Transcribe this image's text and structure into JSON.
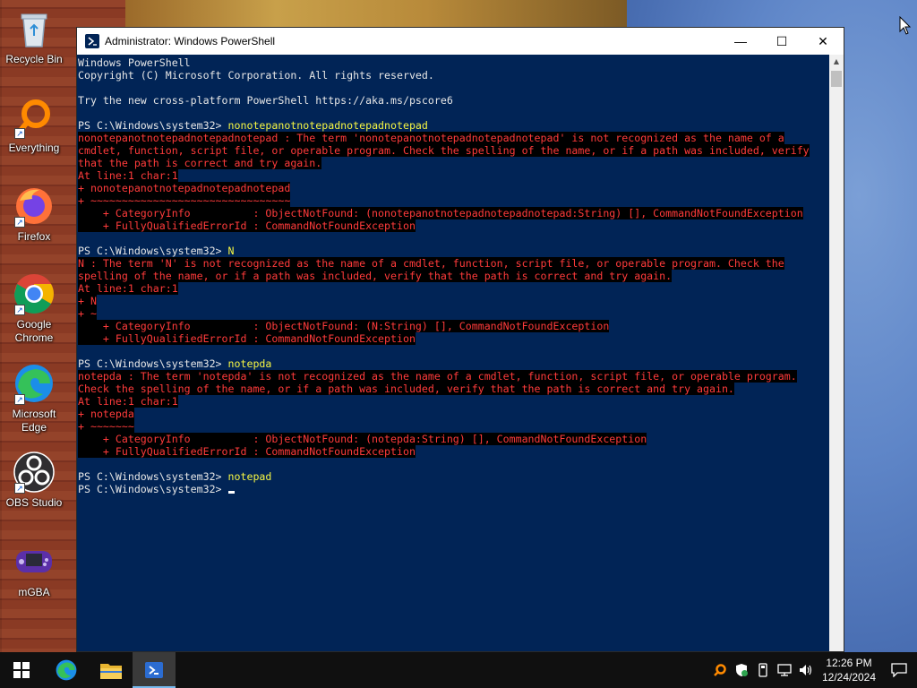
{
  "desktop": {
    "icons": [
      {
        "label": "Recycle Bin"
      },
      {
        "label": "Everything"
      },
      {
        "label": "Firefox"
      },
      {
        "label": "Google Chrome"
      },
      {
        "label": "Microsoft Edge"
      },
      {
        "label": "OBS Studio"
      },
      {
        "label": "mGBA"
      }
    ]
  },
  "window": {
    "title": "Administrator: Windows PowerShell",
    "controls": {
      "minimize": "—",
      "maximize": "☐",
      "close": "✕"
    }
  },
  "console": {
    "lines": [
      {
        "type": "out",
        "text": "Windows PowerShell"
      },
      {
        "type": "out",
        "text": "Copyright (C) Microsoft Corporation. All rights reserved."
      },
      {
        "type": "out",
        "text": ""
      },
      {
        "type": "out",
        "text": "Try the new cross-platform PowerShell https://aka.ms/pscore6"
      },
      {
        "type": "out",
        "text": ""
      },
      {
        "type": "prompt",
        "prompt": "PS C:\\Windows\\system32> ",
        "cmd": "nonotepanotnotepadnotepadnotepad"
      },
      {
        "type": "err",
        "text": "nonotepanotnotepadnotepadnotepad : The term 'nonotepanotnotepadnotepadnotepad' is not recognized as the name of a"
      },
      {
        "type": "err",
        "text": "cmdlet, function, script file, or operable program. Check the spelling of the name, or if a path was included, verify"
      },
      {
        "type": "err",
        "text": "that the path is correct and try again."
      },
      {
        "type": "err",
        "text": "At line:1 char:1"
      },
      {
        "type": "err",
        "text": "+ nonotepanotnotepadnotepadnotepad"
      },
      {
        "type": "err",
        "text": "+ ~~~~~~~~~~~~~~~~~~~~~~~~~~~~~~~~"
      },
      {
        "type": "err",
        "text": "    + CategoryInfo          : ObjectNotFound: (nonotepanotnotepadnotepadnotepad:String) [], CommandNotFoundException"
      },
      {
        "type": "err",
        "text": "    + FullyQualifiedErrorId : CommandNotFoundException"
      },
      {
        "type": "out",
        "text": ""
      },
      {
        "type": "prompt",
        "prompt": "PS C:\\Windows\\system32> ",
        "cmd": "N"
      },
      {
        "type": "err",
        "text": "N : The term 'N' is not recognized as the name of a cmdlet, function, script file, or operable program. Check the"
      },
      {
        "type": "err",
        "text": "spelling of the name, or if a path was included, verify that the path is correct and try again."
      },
      {
        "type": "err",
        "text": "At line:1 char:1"
      },
      {
        "type": "err",
        "text": "+ N"
      },
      {
        "type": "err",
        "text": "+ ~"
      },
      {
        "type": "err",
        "text": "    + CategoryInfo          : ObjectNotFound: (N:String) [], CommandNotFoundException"
      },
      {
        "type": "err",
        "text": "    + FullyQualifiedErrorId : CommandNotFoundException"
      },
      {
        "type": "out",
        "text": ""
      },
      {
        "type": "prompt",
        "prompt": "PS C:\\Windows\\system32> ",
        "cmd": "notepda"
      },
      {
        "type": "err",
        "text": "notepda : The term 'notepda' is not recognized as the name of a cmdlet, function, script file, or operable program."
      },
      {
        "type": "err",
        "text": "Check the spelling of the name, or if a path was included, verify that the path is correct and try again."
      },
      {
        "type": "err",
        "text": "At line:1 char:1"
      },
      {
        "type": "err",
        "text": "+ notepda"
      },
      {
        "type": "err",
        "text": "+ ~~~~~~~"
      },
      {
        "type": "err",
        "text": "    + CategoryInfo          : ObjectNotFound: (notepda:String) [], CommandNotFoundException"
      },
      {
        "type": "err",
        "text": "    + FullyQualifiedErrorId : CommandNotFoundException"
      },
      {
        "type": "out",
        "text": ""
      },
      {
        "type": "prompt",
        "prompt": "PS C:\\Windows\\system32> ",
        "cmd": "notepad"
      },
      {
        "type": "prompt",
        "prompt": "PS C:\\Windows\\system32> ",
        "cmd": "",
        "caret": true
      }
    ]
  },
  "taskbar": {
    "clock": {
      "time": "12:26 PM",
      "date": "12/24/2024"
    },
    "pinned": [
      "start-icon",
      "edge-icon",
      "file-explorer-icon",
      "powershell-icon"
    ],
    "tray": [
      "everything-icon",
      "security-icon",
      "usb-icon",
      "network-icon",
      "volume-icon"
    ]
  },
  "colors": {
    "console_bg": "#012456",
    "console_text": "#e6e6e6",
    "command_text": "#f5f543",
    "error_text": "#ff3b3b"
  }
}
